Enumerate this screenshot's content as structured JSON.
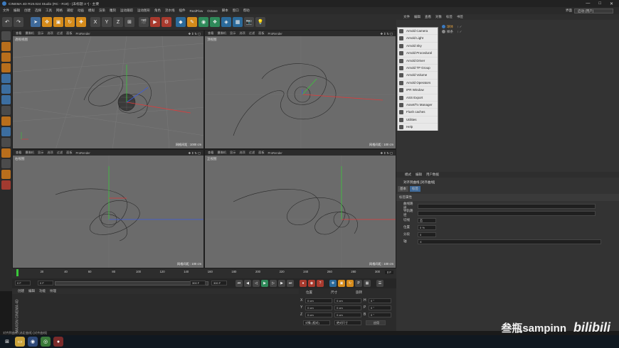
{
  "title": "CINEMA 4D R19.024 Studio (RC - R19) - [未标题 3 *] - 主要",
  "window_controls": [
    "—",
    "□",
    "✕"
  ],
  "menubar": {
    "items": [
      "文件",
      "编辑",
      "创建",
      "选择",
      "工具",
      "网格",
      "捕捉",
      "动画",
      "模拟",
      "渲染",
      "雕刻",
      "运动跟踪",
      "运动图形",
      "角色",
      "流水线",
      "插件",
      "RealFlow",
      "Octane",
      "脚本",
      "窗口",
      "帮助"
    ],
    "layout_label": "界面",
    "layout_value": "启动 (用户)"
  },
  "toolbar": {
    "axis_x": "X",
    "axis_y": "Y",
    "axis_z": "Z"
  },
  "viewport_menu": [
    "查看",
    "摄像机",
    "显示",
    "选项",
    "过滤",
    "面板",
    "ProRender"
  ],
  "viewports": [
    {
      "name": "透视视图",
      "footer": "网格间距 : 1000 cm"
    },
    {
      "name": "顶视图",
      "footer": "网格间距 : 100 cm"
    },
    {
      "name": "右视图",
      "footer": "网格间距 : 100 cm"
    },
    {
      "name": "正视图",
      "footer": "网格间距 : 100 cm"
    }
  ],
  "timeline": {
    "ticks": [
      "0",
      "20",
      "40",
      "60",
      "80",
      "100",
      "120",
      "140",
      "160",
      "180",
      "200",
      "220",
      "240",
      "260",
      "280",
      "300"
    ],
    "end_label": "0 F",
    "current": "0 F",
    "start": "0 F",
    "end": "300 F",
    "end2": "300 F"
  },
  "materials": {
    "menu": [
      "创建",
      "编辑",
      "功能",
      "纹理"
    ]
  },
  "coords": {
    "headers": [
      "位置",
      "尺寸",
      "旋转"
    ],
    "rows": [
      {
        "axis": "X",
        "pos": "0 cm",
        "size": "0 cm",
        "rot_label": "H",
        "rot": "0 °"
      },
      {
        "axis": "Y",
        "pos": "0 cm",
        "size": "0 cm",
        "rot_label": "P",
        "rot": "0 °"
      },
      {
        "axis": "Z",
        "pos": "0 cm",
        "size": "0 cm",
        "rot_label": "B",
        "rot": "0 °"
      }
    ],
    "mode": "对象 (相对)",
    "size_mode": "绝对尺寸",
    "apply": "应用"
  },
  "status": "对齐到曲线 (选定曲线) [对齐曲线]",
  "object_manager": {
    "menu": [
      "文件",
      "编辑",
      "查看",
      "对象",
      "标签",
      "书签"
    ],
    "objects": [
      {
        "name": "球体",
        "color": "#e0a040"
      },
      {
        "name": "样条",
        "color": "#c8c8c8"
      }
    ]
  },
  "arnold_menu": {
    "items": [
      "Arnold Camera",
      "Arnold Light",
      "Arnold Sky",
      "Arnold Procedural",
      "Arnold Driver",
      "Arnold TP Group",
      "Arnold Volume",
      "Arnold Operators",
      "IPR Window",
      "ASS Export",
      "Asset/Tx Manager",
      "Flush caches",
      "Utilities",
      "Help"
    ]
  },
  "attribute_manager": {
    "menu": [
      "模式",
      "编辑",
      "用户数据"
    ],
    "tag_title": "对齐到曲线 [对齐曲线]",
    "tabs": [
      "基本",
      "标签"
    ],
    "section": "标签属性",
    "fields": [
      {
        "label": "曲线路径",
        "value": ""
      },
      {
        "label": "导轨路径",
        "value": ""
      },
      {
        "label": "切线",
        "value": "否"
      },
      {
        "label": "位置",
        "value": "0 %"
      },
      {
        "label": "分段",
        "value": "0"
      },
      {
        "label": "轴",
        "value": "X"
      }
    ]
  },
  "watermark": {
    "author": "叁瓶sampinn",
    "logo": "bilibili"
  },
  "side_logo": "MAXON CINEMA 4D",
  "colors": {
    "accent_orange": "#d58b1b",
    "axis_x": "#e03a3a",
    "axis_y": "#3ac83a",
    "axis_z": "#3a5ae0"
  }
}
